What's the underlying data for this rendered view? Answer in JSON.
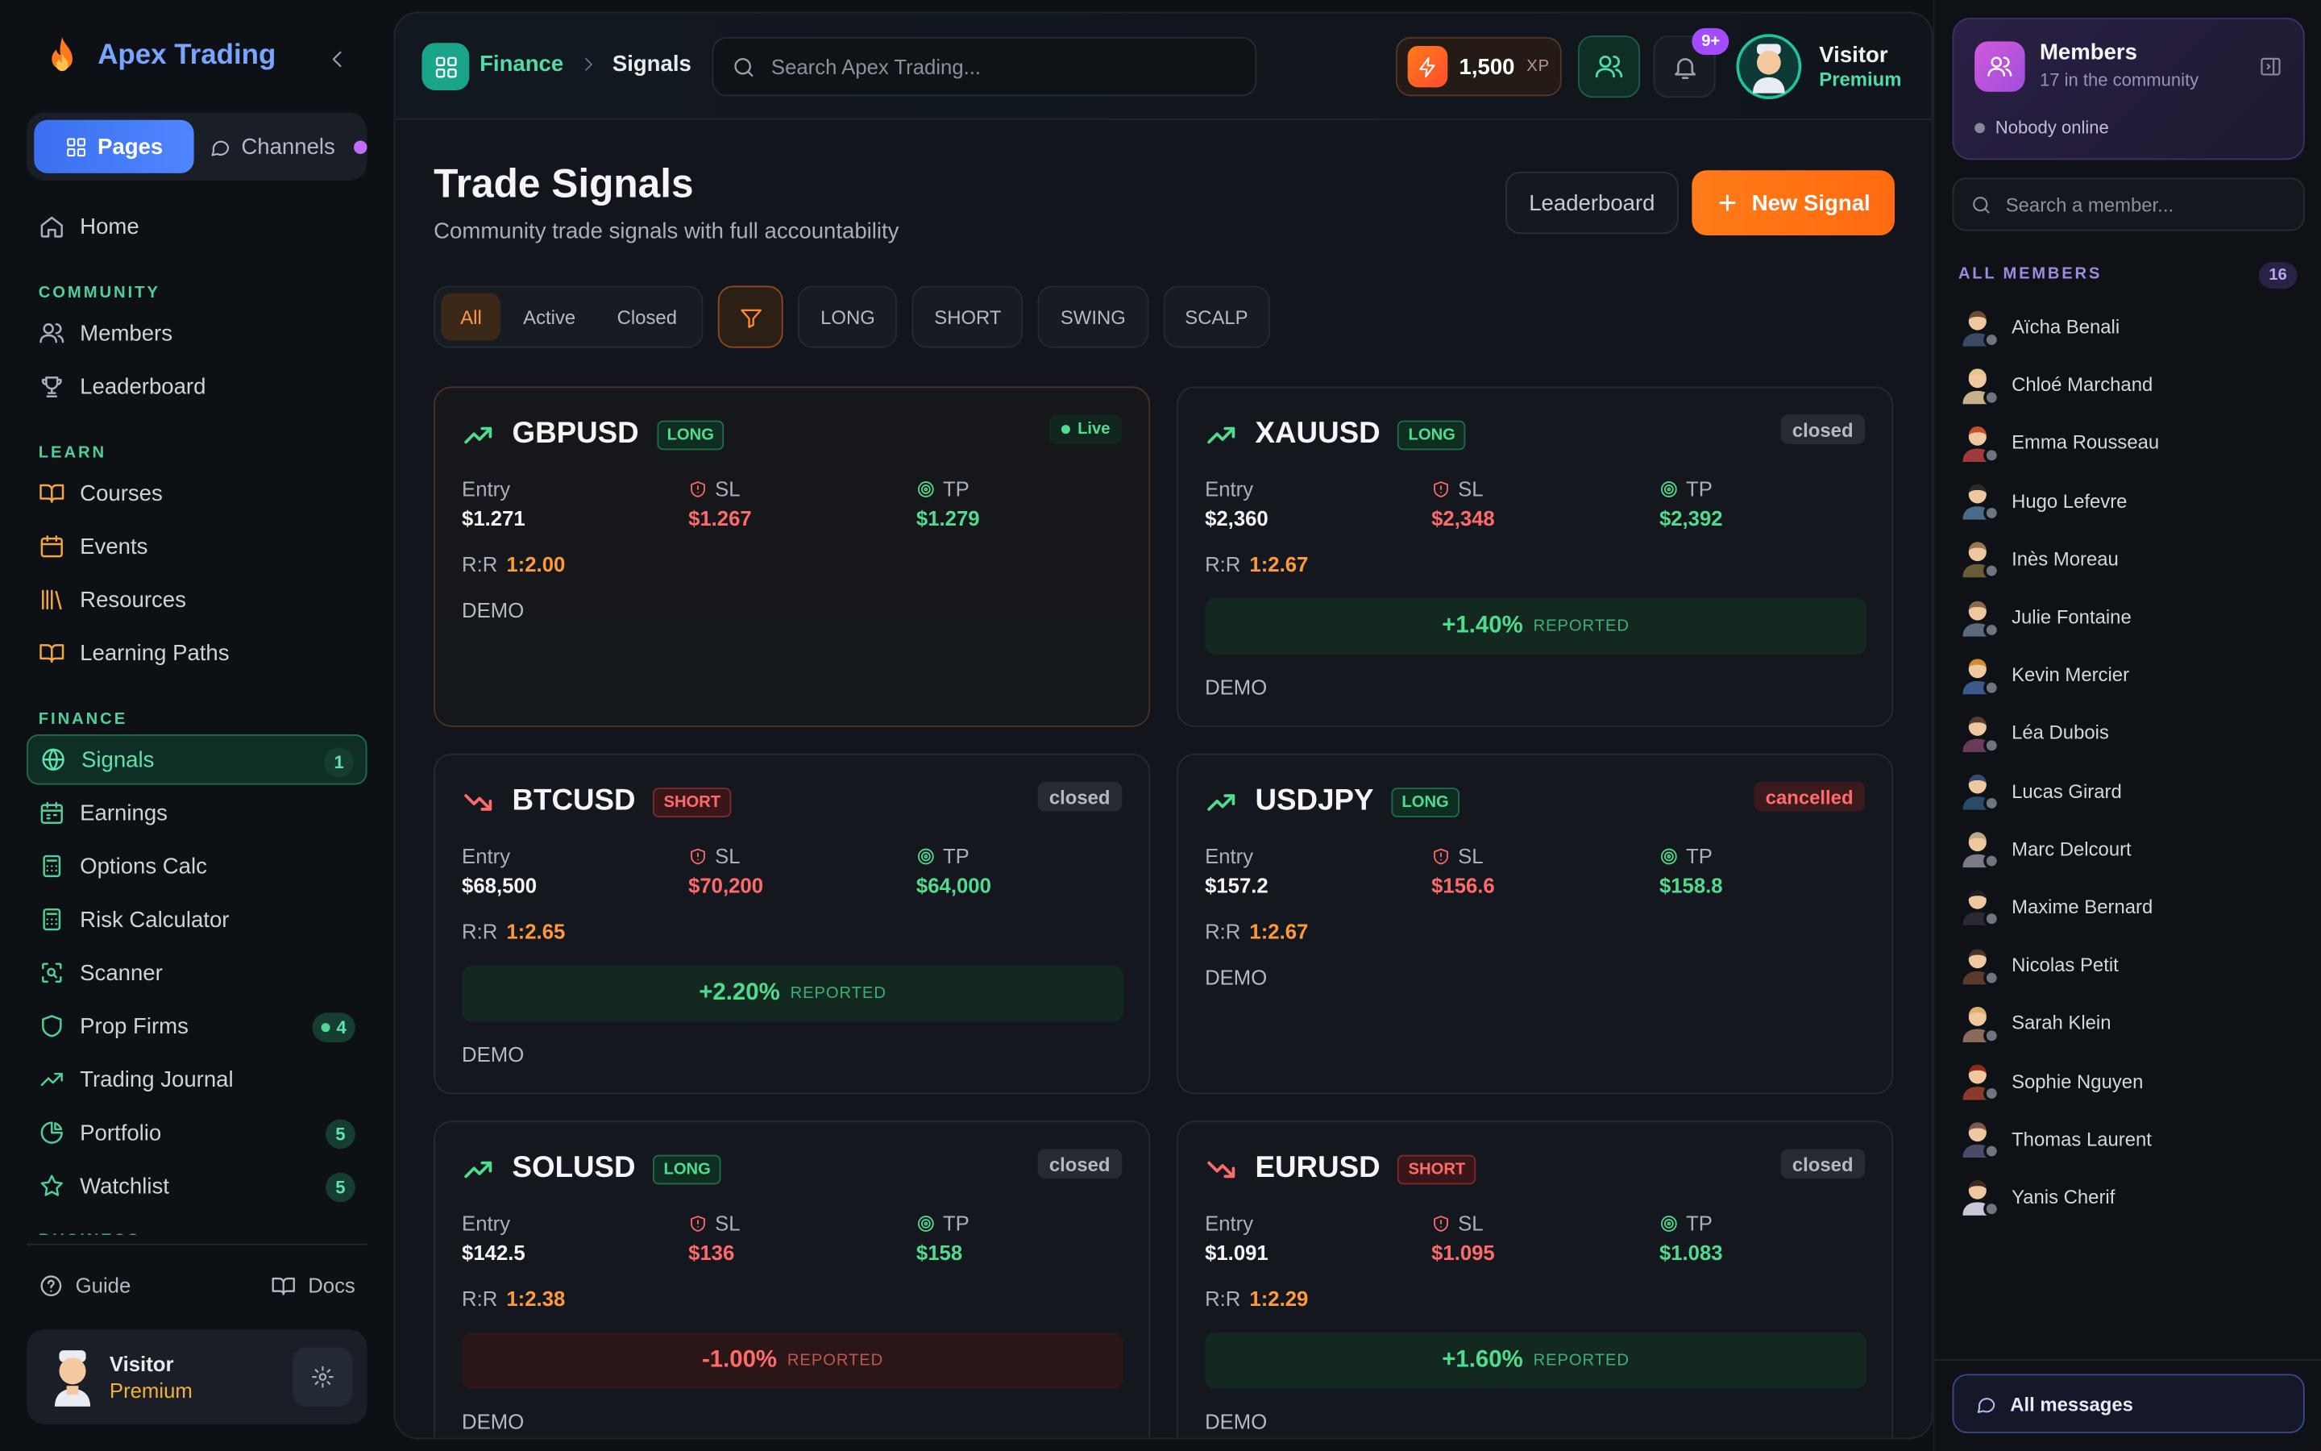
{
  "app": {
    "name": "Apex Trading"
  },
  "sidebar": {
    "switch": {
      "pages": "Pages",
      "channels": "Channels"
    },
    "home": "Home",
    "sections": {
      "community": "COMMUNITY",
      "learn": "LEARN",
      "finance": "FINANCE",
      "business": "BUSINESS"
    },
    "community": [
      {
        "label": "Members"
      },
      {
        "label": "Leaderboard"
      }
    ],
    "learn": [
      {
        "label": "Courses"
      },
      {
        "label": "Events"
      },
      {
        "label": "Resources"
      },
      {
        "label": "Learning Paths"
      }
    ],
    "finance": [
      {
        "label": "Signals",
        "badge": "1"
      },
      {
        "label": "Earnings"
      },
      {
        "label": "Options Calc"
      },
      {
        "label": "Risk Calculator"
      },
      {
        "label": "Scanner"
      },
      {
        "label": "Prop Firms",
        "badge": "4"
      },
      {
        "label": "Trading Journal"
      },
      {
        "label": "Portfolio",
        "badge": "5"
      },
      {
        "label": "Watchlist",
        "badge": "5"
      }
    ],
    "footer": {
      "guide": "Guide",
      "docs": "Docs"
    },
    "user": {
      "name": "Visitor",
      "tier": "Premium"
    }
  },
  "topbar": {
    "breadcrumb": {
      "section": "Finance",
      "page": "Signals"
    },
    "search_placeholder": "Search Apex Trading...",
    "xp": {
      "value": "1,500",
      "unit": "XP"
    },
    "notifications_badge": "9+",
    "user": {
      "name": "Visitor",
      "tier": "Premium"
    }
  },
  "page": {
    "title": "Trade Signals",
    "subtitle": "Community trade signals with full accountability",
    "leaderboard_btn": "Leaderboard",
    "new_btn": "New Signal",
    "status_filters": [
      "All",
      "Active",
      "Closed"
    ],
    "type_filters": [
      "LONG",
      "SHORT",
      "SWING",
      "SCALP"
    ]
  },
  "labels": {
    "entry": "Entry",
    "sl": "SL",
    "tp": "TP",
    "rr": "R:R",
    "reported": "REPORTED"
  },
  "signals": [
    {
      "pair": "GBPUSD",
      "dir": "LONG",
      "status": "Live",
      "entry": "$1.271",
      "sl": "$1.267",
      "tp": "$1.279",
      "rr": "1:2.00",
      "result": "",
      "account": "DEMO"
    },
    {
      "pair": "XAUUSD",
      "dir": "LONG",
      "status": "closed",
      "entry": "$2,360",
      "sl": "$2,348",
      "tp": "$2,392",
      "rr": "1:2.67",
      "result": "+1.40%",
      "account": "DEMO"
    },
    {
      "pair": "BTCUSD",
      "dir": "SHORT",
      "status": "closed",
      "entry": "$68,500",
      "sl": "$70,200",
      "tp": "$64,000",
      "rr": "1:2.65",
      "result": "+2.20%",
      "account": "DEMO"
    },
    {
      "pair": "USDJPY",
      "dir": "LONG",
      "status": "cancelled",
      "entry": "$157.2",
      "sl": "$156.6",
      "tp": "$158.8",
      "rr": "1:2.67",
      "result": "",
      "account": "DEMO"
    },
    {
      "pair": "SOLUSD",
      "dir": "LONG",
      "status": "closed",
      "entry": "$142.5",
      "sl": "$136",
      "tp": "$158",
      "rr": "1:2.38",
      "result": "-1.00%",
      "account": "DEMO"
    },
    {
      "pair": "EURUSD",
      "dir": "SHORT",
      "status": "closed",
      "entry": "$1.091",
      "sl": "$1.095",
      "tp": "$1.083",
      "rr": "1:2.29",
      "result": "+1.60%",
      "account": "DEMO"
    }
  ],
  "members_panel": {
    "title": "Members",
    "subtitle": "17 in the community",
    "online": "Nobody online",
    "search_placeholder": "Search a member...",
    "all_label": "ALL MEMBERS",
    "count": "16",
    "members": [
      "Aïcha Benali",
      "Chloé Marchand",
      "Emma Rousseau",
      "Hugo Lefevre",
      "Inès Moreau",
      "Julie Fontaine",
      "Kevin Mercier",
      "Léa Dubois",
      "Lucas Girard",
      "Marc Delcourt",
      "Maxime Bernard",
      "Nicolas Petit",
      "Sarah Klein",
      "Sophie Nguyen",
      "Thomas Laurent",
      "Yanis Cherif"
    ],
    "all_messages": "All messages"
  },
  "colors": {
    "accent_green": "#4fdcaa",
    "accent_orange": "#ff7b1a",
    "loss_red": "#ff6b6b",
    "brand_blue": "#7aa5ff"
  }
}
